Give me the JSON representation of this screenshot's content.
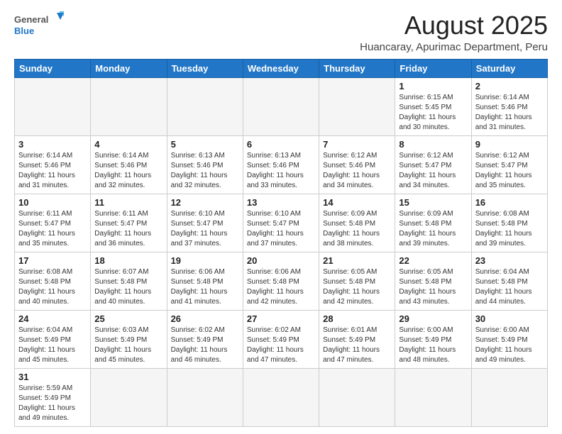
{
  "logo": {
    "text_general": "General",
    "text_blue": "Blue"
  },
  "header": {
    "month_title": "August 2025",
    "location": "Huancaray, Apurimac Department, Peru"
  },
  "weekdays": [
    "Sunday",
    "Monday",
    "Tuesday",
    "Wednesday",
    "Thursday",
    "Friday",
    "Saturday"
  ],
  "weeks": [
    [
      {
        "day": "",
        "info": ""
      },
      {
        "day": "",
        "info": ""
      },
      {
        "day": "",
        "info": ""
      },
      {
        "day": "",
        "info": ""
      },
      {
        "day": "",
        "info": ""
      },
      {
        "day": "1",
        "info": "Sunrise: 6:15 AM\nSunset: 5:45 PM\nDaylight: 11 hours and 30 minutes."
      },
      {
        "day": "2",
        "info": "Sunrise: 6:14 AM\nSunset: 5:46 PM\nDaylight: 11 hours and 31 minutes."
      }
    ],
    [
      {
        "day": "3",
        "info": "Sunrise: 6:14 AM\nSunset: 5:46 PM\nDaylight: 11 hours and 31 minutes."
      },
      {
        "day": "4",
        "info": "Sunrise: 6:14 AM\nSunset: 5:46 PM\nDaylight: 11 hours and 32 minutes."
      },
      {
        "day": "5",
        "info": "Sunrise: 6:13 AM\nSunset: 5:46 PM\nDaylight: 11 hours and 32 minutes."
      },
      {
        "day": "6",
        "info": "Sunrise: 6:13 AM\nSunset: 5:46 PM\nDaylight: 11 hours and 33 minutes."
      },
      {
        "day": "7",
        "info": "Sunrise: 6:12 AM\nSunset: 5:46 PM\nDaylight: 11 hours and 34 minutes."
      },
      {
        "day": "8",
        "info": "Sunrise: 6:12 AM\nSunset: 5:47 PM\nDaylight: 11 hours and 34 minutes."
      },
      {
        "day": "9",
        "info": "Sunrise: 6:12 AM\nSunset: 5:47 PM\nDaylight: 11 hours and 35 minutes."
      }
    ],
    [
      {
        "day": "10",
        "info": "Sunrise: 6:11 AM\nSunset: 5:47 PM\nDaylight: 11 hours and 35 minutes."
      },
      {
        "day": "11",
        "info": "Sunrise: 6:11 AM\nSunset: 5:47 PM\nDaylight: 11 hours and 36 minutes."
      },
      {
        "day": "12",
        "info": "Sunrise: 6:10 AM\nSunset: 5:47 PM\nDaylight: 11 hours and 37 minutes."
      },
      {
        "day": "13",
        "info": "Sunrise: 6:10 AM\nSunset: 5:47 PM\nDaylight: 11 hours and 37 minutes."
      },
      {
        "day": "14",
        "info": "Sunrise: 6:09 AM\nSunset: 5:48 PM\nDaylight: 11 hours and 38 minutes."
      },
      {
        "day": "15",
        "info": "Sunrise: 6:09 AM\nSunset: 5:48 PM\nDaylight: 11 hours and 39 minutes."
      },
      {
        "day": "16",
        "info": "Sunrise: 6:08 AM\nSunset: 5:48 PM\nDaylight: 11 hours and 39 minutes."
      }
    ],
    [
      {
        "day": "17",
        "info": "Sunrise: 6:08 AM\nSunset: 5:48 PM\nDaylight: 11 hours and 40 minutes."
      },
      {
        "day": "18",
        "info": "Sunrise: 6:07 AM\nSunset: 5:48 PM\nDaylight: 11 hours and 40 minutes."
      },
      {
        "day": "19",
        "info": "Sunrise: 6:06 AM\nSunset: 5:48 PM\nDaylight: 11 hours and 41 minutes."
      },
      {
        "day": "20",
        "info": "Sunrise: 6:06 AM\nSunset: 5:48 PM\nDaylight: 11 hours and 42 minutes."
      },
      {
        "day": "21",
        "info": "Sunrise: 6:05 AM\nSunset: 5:48 PM\nDaylight: 11 hours and 42 minutes."
      },
      {
        "day": "22",
        "info": "Sunrise: 6:05 AM\nSunset: 5:48 PM\nDaylight: 11 hours and 43 minutes."
      },
      {
        "day": "23",
        "info": "Sunrise: 6:04 AM\nSunset: 5:48 PM\nDaylight: 11 hours and 44 minutes."
      }
    ],
    [
      {
        "day": "24",
        "info": "Sunrise: 6:04 AM\nSunset: 5:49 PM\nDaylight: 11 hours and 45 minutes."
      },
      {
        "day": "25",
        "info": "Sunrise: 6:03 AM\nSunset: 5:49 PM\nDaylight: 11 hours and 45 minutes."
      },
      {
        "day": "26",
        "info": "Sunrise: 6:02 AM\nSunset: 5:49 PM\nDaylight: 11 hours and 46 minutes."
      },
      {
        "day": "27",
        "info": "Sunrise: 6:02 AM\nSunset: 5:49 PM\nDaylight: 11 hours and 47 minutes."
      },
      {
        "day": "28",
        "info": "Sunrise: 6:01 AM\nSunset: 5:49 PM\nDaylight: 11 hours and 47 minutes."
      },
      {
        "day": "29",
        "info": "Sunrise: 6:00 AM\nSunset: 5:49 PM\nDaylight: 11 hours and 48 minutes."
      },
      {
        "day": "30",
        "info": "Sunrise: 6:00 AM\nSunset: 5:49 PM\nDaylight: 11 hours and 49 minutes."
      }
    ],
    [
      {
        "day": "31",
        "info": "Sunrise: 5:59 AM\nSunset: 5:49 PM\nDaylight: 11 hours and 49 minutes."
      },
      {
        "day": "",
        "info": ""
      },
      {
        "day": "",
        "info": ""
      },
      {
        "day": "",
        "info": ""
      },
      {
        "day": "",
        "info": ""
      },
      {
        "day": "",
        "info": ""
      },
      {
        "day": "",
        "info": ""
      }
    ]
  ]
}
